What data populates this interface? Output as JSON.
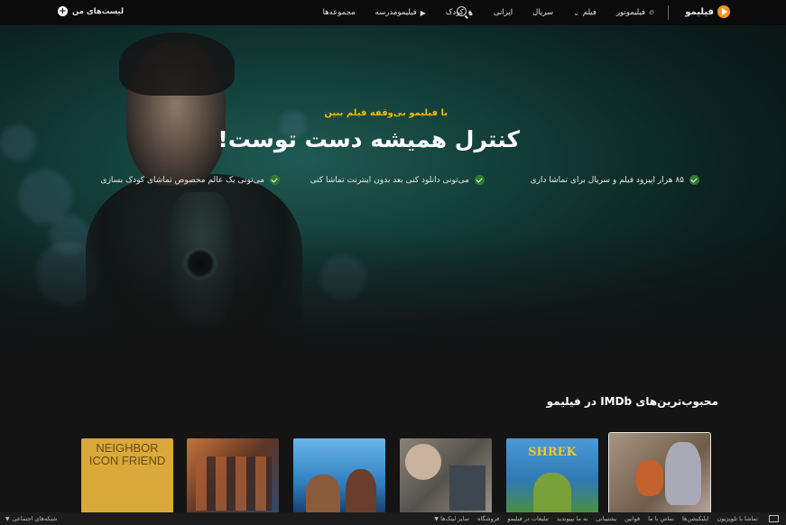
{
  "nav": {
    "logo_text": "فیلیمو",
    "items": [
      {
        "label": "فیلیموتور",
        "icon": "flame-icon"
      },
      {
        "label": "فیلم",
        "icon": "chevron-down-icon"
      },
      {
        "label": "سریال",
        "icon": ""
      },
      {
        "label": "ایرانی",
        "icon": ""
      },
      {
        "label": "کودک",
        "icon": "unicorn-icon"
      },
      {
        "label": "فیلیمومدرسه",
        "icon": "play-icon"
      },
      {
        "label": "مجموعه‌ها",
        "icon": ""
      }
    ],
    "my_lists_label": "لیست‌های من"
  },
  "hero": {
    "kicker": "با فیلیمو بی‌وقفه فیلم ببین",
    "title": "کنترل همیشه دست توست!",
    "features": [
      "۸۵ هزار اپیزود فیلم و سریال برای تماشا داری",
      "می‌تونی دانلود کنی بعد بدون اینترنت تماشا کنی",
      "می‌تونی یک عالم محصوص تماشای کودک بسازی"
    ]
  },
  "section": {
    "title": "محبوب‌ترین‌های IMDb در فیلیمو",
    "posters": [
      {
        "name": "zootopia",
        "label": "",
        "bg": "#8e7f6c"
      },
      {
        "name": "shrek",
        "label": "SHREK",
        "bg": "#3b86c9"
      },
      {
        "name": "drama-family",
        "label": "",
        "bg": "#6e6a62"
      },
      {
        "name": "moana",
        "label": "",
        "bg": "#3c8fc9"
      },
      {
        "name": "action-ensemble",
        "label": "",
        "bg": "#8a4c2c"
      },
      {
        "name": "neighbor-icon-friend",
        "label": "NEIGHBOR ICON FRIEND",
        "bg": "#e0b241"
      }
    ]
  },
  "footer": {
    "links": [
      "تماشا با تلویزیون",
      "اپلیکیشن‌ها",
      "تماس با ما",
      "قوانین",
      "پشتیبانی",
      "به ما بپیوندید",
      "تبلیغات در فیلیمو",
      "فروشگاه",
      "سایر لینک‌ها"
    ],
    "social_label": "شبکه‌های اجتماعی"
  }
}
